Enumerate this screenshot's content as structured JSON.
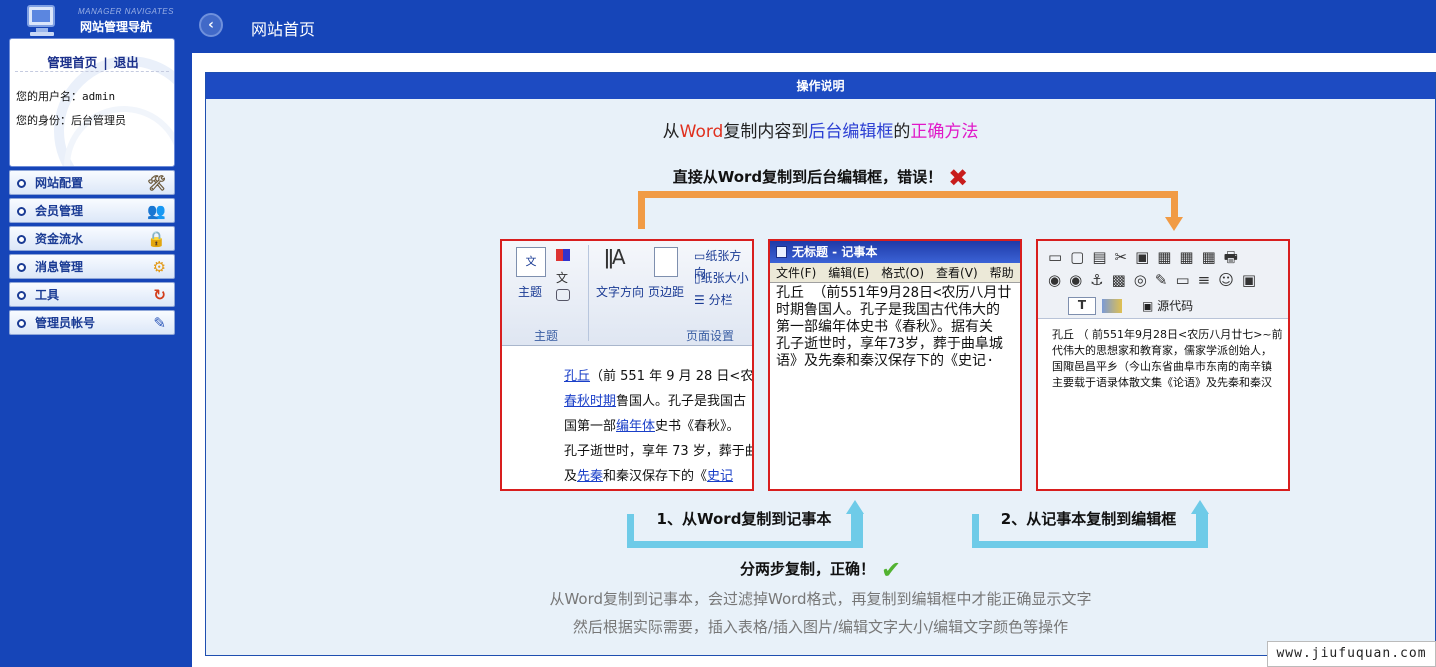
{
  "sidebar": {
    "logo_en": "MANAGER NAVIGATES",
    "logo_cn": "网站管理导航",
    "links": {
      "home": "管理首页",
      "sep": "|",
      "logout": "退出"
    },
    "username_label": "您的用户名：",
    "username": "admin",
    "role_label": "您的身份：",
    "role": "后台管理员",
    "menu": [
      {
        "label": "网站配置",
        "icon": "🛠"
      },
      {
        "label": "会员管理",
        "icon": "👥"
      },
      {
        "label": "资金流水",
        "icon": "🔒"
      },
      {
        "label": "消息管理",
        "icon": "⚙"
      },
      {
        "label": "工具",
        "icon": "↻"
      },
      {
        "label": "管理员帐号",
        "icon": "✎"
      }
    ]
  },
  "header": {
    "back_icon": "‹",
    "title": "网站首页"
  },
  "panel": {
    "heading": "操作说明",
    "title_parts": [
      "从",
      "Word",
      "复制内容到",
      "后台编辑框",
      "的",
      "正确方法"
    ],
    "wrong_text": "直接从Word复制到后台编辑框，错误！",
    "wrong_icon": "✖",
    "step1": "1、从Word复制到记事本",
    "step2": "2、从记事本复制到编辑框",
    "right_text": "分两步复制，正确！",
    "right_icon": "✔",
    "note1": "从Word复制到记事本，会过滤掉Word格式，再复制到编辑框中才能正确显示文字",
    "note2": "然后根据实际需要，插入表格/插入图片/编辑文字大小/编辑文字颜色等操作"
  },
  "word_box": {
    "theme": "主题",
    "theme_group": "主题",
    "text_dir": "文字方向",
    "margin": "页边距",
    "paper_dir": "纸张方向",
    "paper_size": "纸张大小",
    "columns": "分栏",
    "page_setup": "页面设置",
    "lines": [
      [
        "孔丘",
        "（前 551 年 9 月 28 日<农"
      ],
      [
        "春秋时期",
        "鲁国人。孔子是我国古"
      ],
      [
        "国第一部",
        "编年体",
        "史书《春秋》。"
      ],
      [
        "",
        "孔子逝世时，享年 73 岁，葬于曲"
      ],
      [
        "及",
        "先秦",
        "和秦汉保存下的《",
        "史记"
      ]
    ]
  },
  "notepad_box": {
    "title": "无标题 - 记事本",
    "menus": [
      "文件(F)",
      "编辑(E)",
      "格式(O)",
      "查看(V)",
      "帮助"
    ],
    "lines": [
      "孔丘 （前551年9月28日<农历八月廿",
      "时期鲁国人。孔子是我国古代伟大的",
      "第一部编年体史书《春秋》。据有关",
      "孔子逝世时，享年73岁，葬于曲阜城",
      "语》及先秦和秦汉保存下的《史记·"
    ]
  },
  "editor_box": {
    "source_label": "源代码",
    "toolbar_row1": "▭▢▤✂▣▦▦▦🖶",
    "toolbar_row2": "◉◉⚓▩◎✎▭≡☺▣",
    "lines": [
      "孔丘 （ 前551年9月28日<农历八月廿七>~前",
      "代伟大的思想家和教育家，儒家学派创始人，",
      "国陬邑昌平乡（今山东省曲阜市东南的南辛镇",
      "主要载于语录体散文集《论语》及先秦和秦汉"
    ]
  },
  "watermark": "www.jiufuquan.com"
}
